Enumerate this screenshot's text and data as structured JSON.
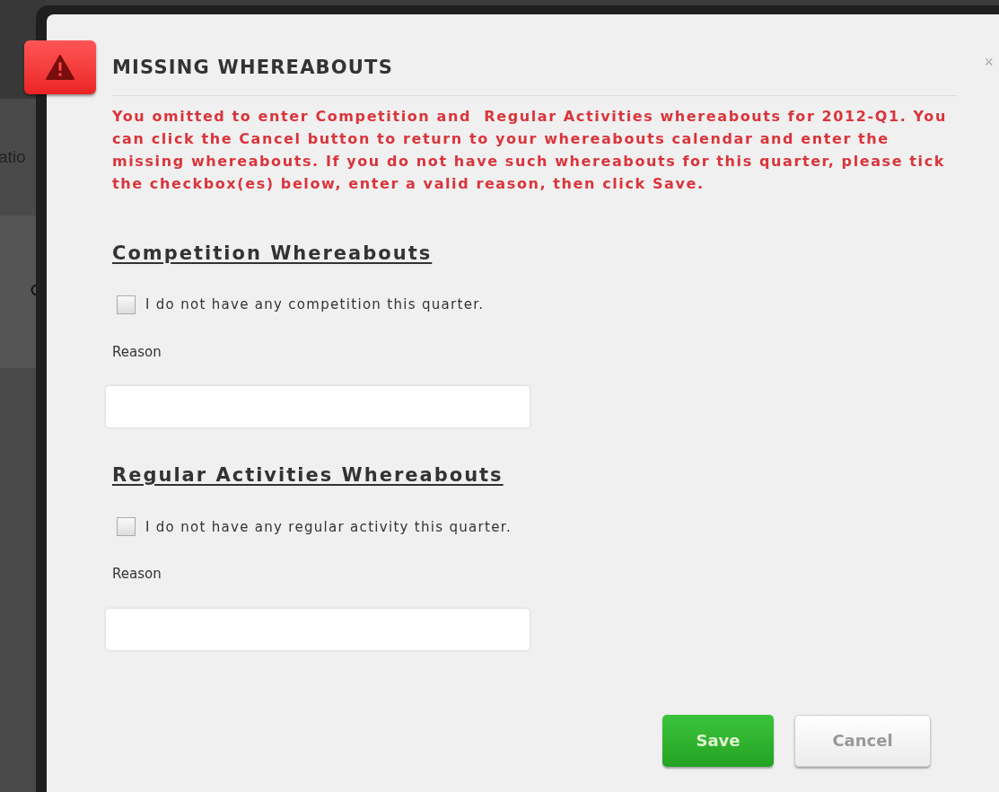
{
  "background": {
    "partial_label": "atio"
  },
  "dialog": {
    "title": "MISSING WHEREABOUTS",
    "close": "×",
    "message": "You omitted to enter Competition and  Regular Activities whereabouts for 2012-Q1. You can click the Cancel button to return to your whereabouts calendar and enter the missing whereabouts. If you do not have such whereabouts for this quarter, please tick the checkbox(es) below, enter a valid reason, then click Save.",
    "sections": [
      {
        "heading": "Competition Whereabouts",
        "checkbox_label": "I do not have any competition this quarter.",
        "checked": false,
        "reason_label": "Reason"
      },
      {
        "heading": "Regular Activities Whereabouts",
        "checkbox_label": "I do not have any regular activity this quarter.",
        "checked": false,
        "reason_label": "Reason"
      }
    ],
    "buttons": [
      {
        "label": "Save",
        "kind": "primary"
      },
      {
        "label": "Cancel",
        "kind": "secondary"
      }
    ]
  }
}
